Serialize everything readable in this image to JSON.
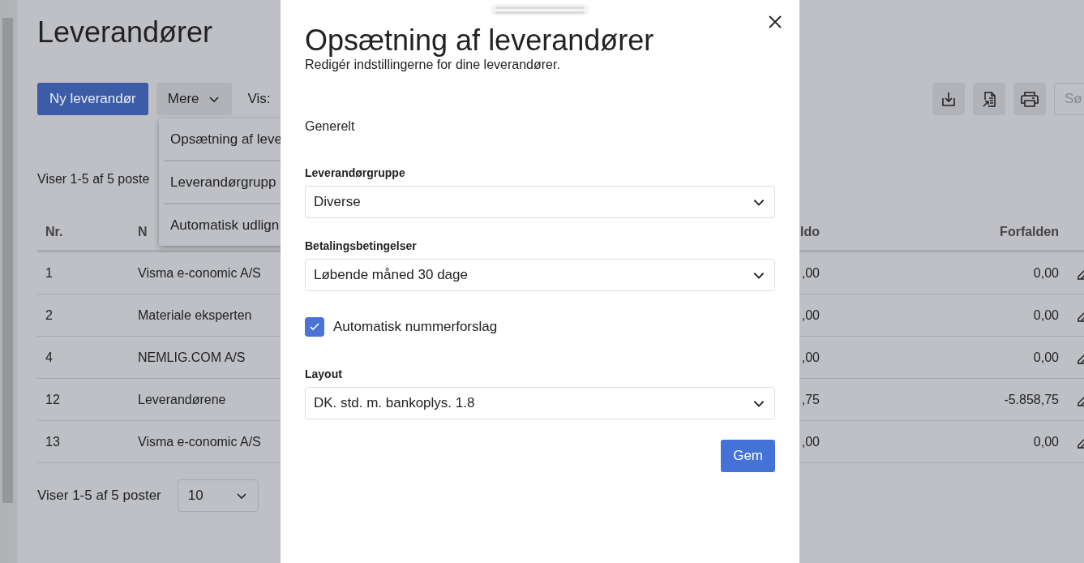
{
  "page": {
    "title": "Leverandører",
    "new_button": "Ny leverandør",
    "more_button": "Mere",
    "view_label": "Vis:",
    "search": {
      "placeholder": "Sø"
    },
    "count_top": "Viser 1-5 af 5 poste",
    "count_bottom": "Viser 1-5 af 5 poster",
    "page_size": "10",
    "menu": [
      "Opsætning af leve",
      "Leverandørgrupp",
      "Automatisk udlign"
    ],
    "table": {
      "columns": [
        "Nr.",
        "N",
        "ldo",
        "Forfalden"
      ],
      "rows": [
        {
          "nr": "1",
          "name": "Visma e-conomic A/S",
          "column_3": ",00",
          "due": "0,00"
        },
        {
          "nr": "2",
          "name": "Materiale eksperten",
          "column_3": ",00",
          "due": "0,00"
        },
        {
          "nr": "4",
          "name": "NEMLIG.COM A/S",
          "column_3": ",00",
          "due": "0,00"
        },
        {
          "nr": "12",
          "name": "Leverandørene",
          "column_3": ",75",
          "due": "-5.858,75"
        },
        {
          "nr": "13",
          "name": "Visma e-conomic A/S",
          "column_3": ",00",
          "due": "0,00"
        }
      ]
    }
  },
  "dialog": {
    "title": "Opsætning af leverandører",
    "subtitle": "Redigér indstillingerne for dine leverandører.",
    "section": "Generelt",
    "fields": [
      {
        "kind": "select",
        "label": "Leverandørgruppe",
        "value": "Diverse"
      },
      {
        "kind": "select",
        "label": "Betalingsbetingelser",
        "value": "Løbende måned 30 dage"
      },
      {
        "kind": "checkbox",
        "label": "Automatisk nummerforslag",
        "checked": true
      },
      {
        "kind": "select",
        "label": "Layout",
        "value": "DK. std. m. bankoplys. 1.8"
      }
    ],
    "save_button": "Gem"
  }
}
